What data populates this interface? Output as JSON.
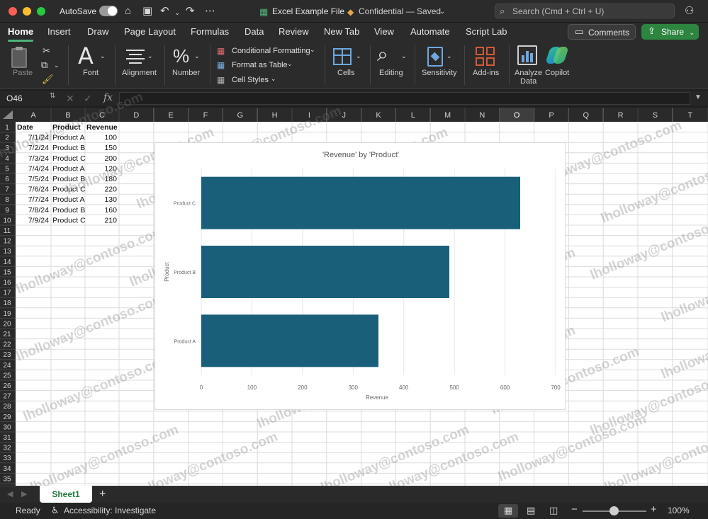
{
  "titlebar": {
    "autosave_label": "AutoSave",
    "file_name": "Excel Example File",
    "sensitivity": "Confidential — Saved",
    "search_placeholder": "Search (Cmd + Ctrl + U)"
  },
  "tabs": [
    "Home",
    "Insert",
    "Draw",
    "Page Layout",
    "Formulas",
    "Data",
    "Review",
    "New Tab",
    "View",
    "Automate",
    "Script Lab"
  ],
  "actions": {
    "comments": "Comments",
    "share": "Share"
  },
  "ribbon": {
    "paste": "Paste",
    "font": "Font",
    "alignment": "Alignment",
    "number": "Number",
    "conditional_formatting": "Conditional Formatting",
    "format_as_table": "Format as Table",
    "cell_styles": "Cell Styles",
    "cells": "Cells",
    "editing": "Editing",
    "sensitivity": "Sensitivity",
    "addins": "Add-ins",
    "analyze_data_1": "Analyze",
    "analyze_data_2": "Data",
    "copilot": "Copilot"
  },
  "formula_bar": {
    "name_box": "O46",
    "fx": "fx"
  },
  "columns": [
    "A",
    "B",
    "C",
    "D",
    "E",
    "F",
    "G",
    "H",
    "I",
    "J",
    "K",
    "L",
    "M",
    "N",
    "O",
    "P",
    "Q",
    "R",
    "S",
    "T"
  ],
  "row_count": 37,
  "table": {
    "headers": [
      "Date",
      "Product",
      "Revenue"
    ],
    "rows": [
      [
        "7/1/24",
        "Product A",
        "100"
      ],
      [
        "7/2/24",
        "Product B",
        "150"
      ],
      [
        "7/3/24",
        "Product C",
        "200"
      ],
      [
        "7/4/24",
        "Product A",
        "120"
      ],
      [
        "7/5/24",
        "Product B",
        "180"
      ],
      [
        "7/6/24",
        "Product C",
        "220"
      ],
      [
        "7/7/24",
        "Product A",
        "130"
      ],
      [
        "7/8/24",
        "Product B",
        "160"
      ],
      [
        "7/9/24",
        "Product C",
        "210"
      ]
    ]
  },
  "chart_data": {
    "type": "bar",
    "orientation": "horizontal",
    "title": "'Revenue' by 'Product'",
    "xlabel": "Revenue",
    "ylabel": "Product",
    "categories": [
      "Product C",
      "Product B",
      "Product A"
    ],
    "values": [
      630,
      490,
      350
    ],
    "xlim": [
      0,
      700
    ],
    "xticks": [
      0,
      100,
      200,
      300,
      400,
      500,
      600,
      700
    ],
    "grid": true,
    "color": "#1a5f7a"
  },
  "watermark": "lholloway@contoso.com",
  "sheet_tabs": {
    "active": "Sheet1",
    "add": "+"
  },
  "status": {
    "ready": "Ready",
    "accessibility": "Accessibility: Investigate",
    "zoom": "100%"
  },
  "colors": {
    "accent_green": "#4fb37a",
    "share_green": "#2e8540",
    "bar": "#1a5f7a"
  }
}
